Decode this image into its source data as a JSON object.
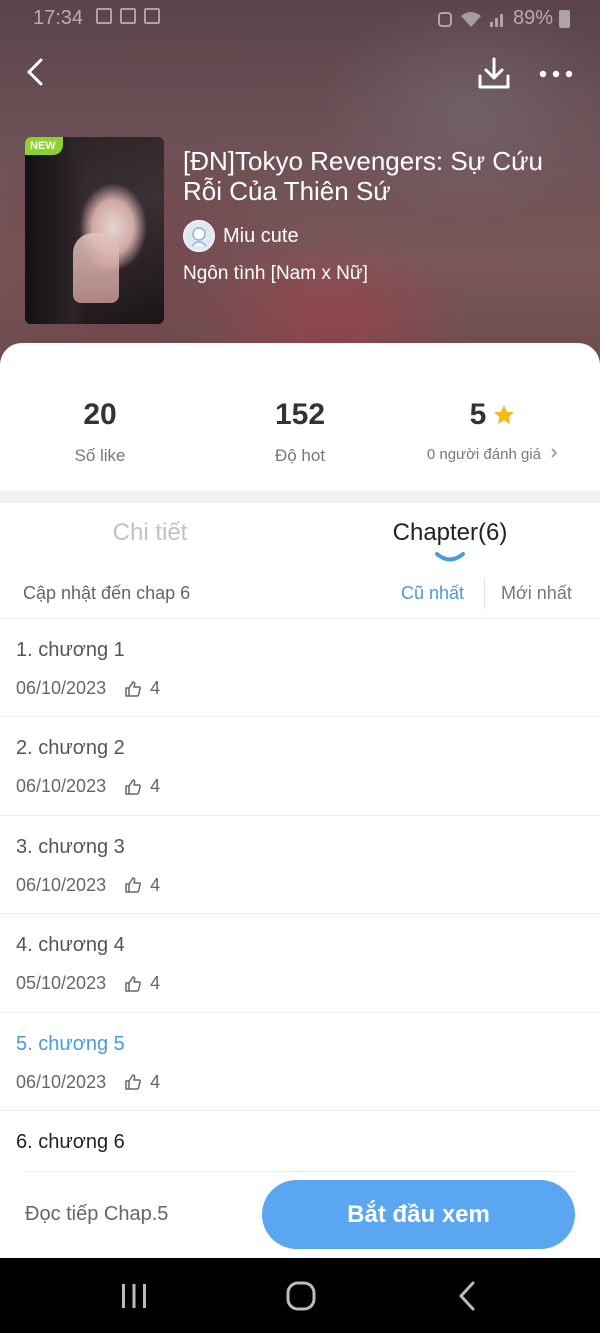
{
  "status_bar": {
    "time": "17:34",
    "battery": "89%"
  },
  "comic": {
    "badge": "NEW",
    "title": "[ĐN]Tokyo Revengers: Sự Cứu Rỗi Của Thiên Sứ",
    "author": "Miu cute",
    "genre": "Ngôn tình [Nam x Nữ]"
  },
  "stats": {
    "likes_value": "20",
    "likes_label": "Số like",
    "hot_value": "152",
    "hot_label": "Độ hot",
    "rating_value": "5",
    "rating_label": "0 người đánh giá"
  },
  "tabs": {
    "details": "Chi tiết",
    "chapters": "Chapter(6)"
  },
  "sort": {
    "update_text": "Cập nhật đến chap 6",
    "oldest": "Cũ nhất",
    "newest": "Mới nhất"
  },
  "chapters": [
    {
      "name": "1. chương 1",
      "date": "06/10/2023",
      "likes": "4"
    },
    {
      "name": "2. chương 2",
      "date": "06/10/2023",
      "likes": "4"
    },
    {
      "name": "3. chương 3",
      "date": "06/10/2023",
      "likes": "4"
    },
    {
      "name": "4. chương 4",
      "date": "05/10/2023",
      "likes": "4"
    },
    {
      "name": "5. chương 5",
      "date": "06/10/2023",
      "likes": "4"
    },
    {
      "name": "6. chương 6"
    }
  ],
  "bottom": {
    "continue_text": "Đọc tiếp Chap.5",
    "start_button": "Bắt đầu xem"
  },
  "colors": {
    "accent": "#5aa6f0",
    "link": "#4a9bd9",
    "star": "#f6b916",
    "new_badge": "#8bd12f"
  }
}
